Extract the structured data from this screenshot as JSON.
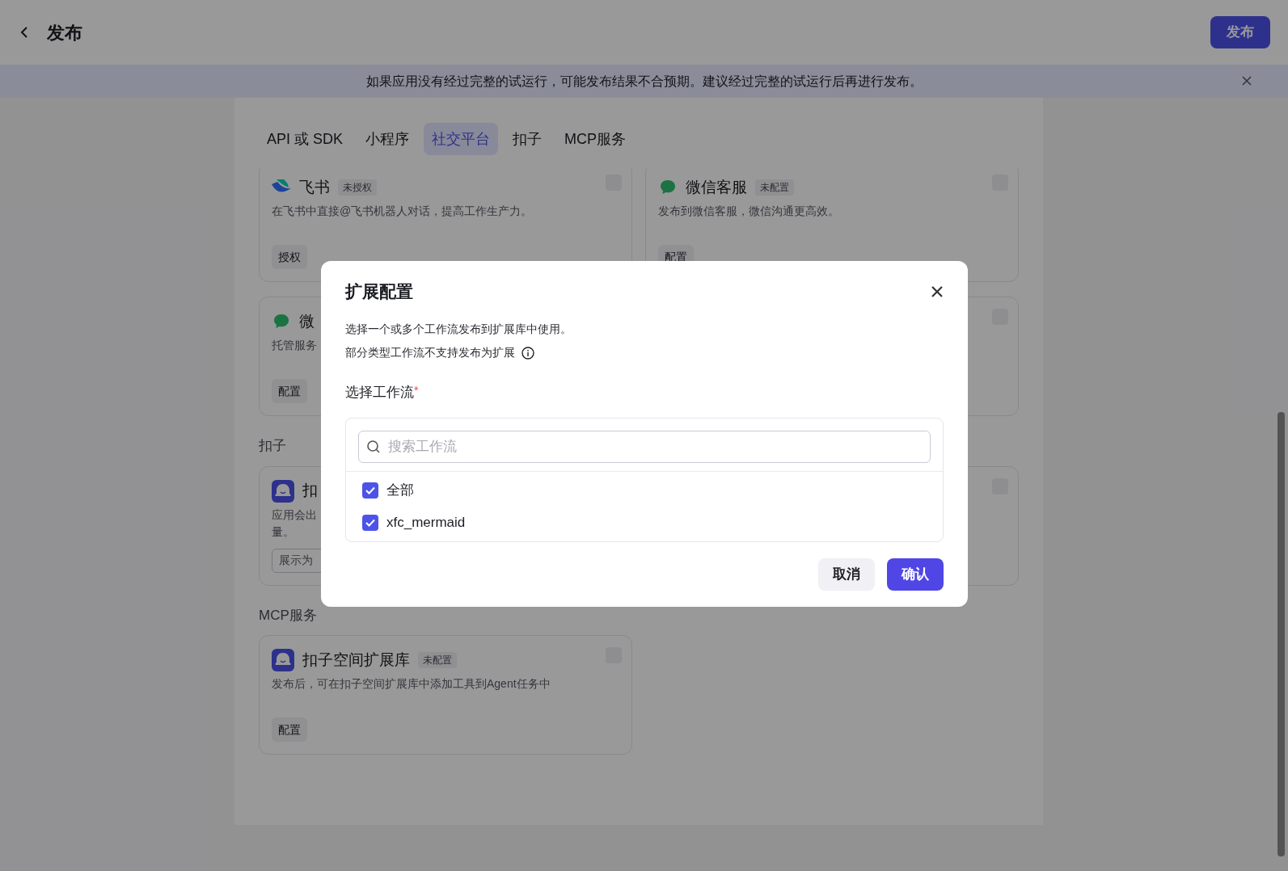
{
  "header": {
    "title": "发布",
    "publish_button": "发布"
  },
  "banner": {
    "text": "如果应用没有经过完整的试运行，可能发布结果不合预期。建议经过完整的试运行后再进行发布。"
  },
  "tabs": [
    {
      "label": "API 或 SDK",
      "selected": false
    },
    {
      "label": "小程序",
      "selected": false
    },
    {
      "label": "社交平台",
      "selected": true
    },
    {
      "label": "扣子",
      "selected": false
    },
    {
      "label": "MCP服务",
      "selected": false
    }
  ],
  "sections": [
    {
      "cards": [
        {
          "title": "飞书",
          "badge": "未授权",
          "description": [
            "在飞书中直接@飞书机器人对话，提高工作生产力。"
          ],
          "action": "授权",
          "kind": "button",
          "checked": false
        },
        {
          "title": "微信客服",
          "badge": "未配置",
          "description": [
            "发布到微信客服，微信沟通更高效。"
          ],
          "action": "配置",
          "kind": "button",
          "checked": false
        },
        {
          "title": "微",
          "description": [
            "托管服务"
          ],
          "action": "配置",
          "kind": "button"
        },
        {
          "checked": false
        }
      ]
    },
    {
      "heading": "扣子",
      "cards": [
        {
          "title": "扣",
          "description": [
            "应用会出",
            "量。"
          ],
          "action": "展示为",
          "kind": "select"
        },
        {
          "checked": false
        }
      ]
    },
    {
      "heading": "MCP服务",
      "cards": [
        {
          "title": "扣子空间扩展库",
          "badge": "未配置",
          "description": [
            "发布后，可在扣子空间扩展库中添加工具到Agent任务中"
          ],
          "action": "配置",
          "kind": "button",
          "checked": false
        }
      ]
    }
  ],
  "dialog": {
    "title": "扩展配置",
    "lines": [
      "选择一个或多个工作流发布到扩展库中使用。",
      "部分类型工作流不支持发布为扩展"
    ],
    "field_label": "选择工作流",
    "required_mark": "*",
    "search": {
      "placeholder": "搜索工作流"
    },
    "options": [
      {
        "label": "全部",
        "checked": true
      },
      {
        "label": "xfc_mermaid",
        "checked": true
      }
    ],
    "buttons": [
      {
        "label": "取消",
        "kind": "secondary"
      },
      {
        "label": "确认",
        "kind": "primary"
      }
    ]
  }
}
